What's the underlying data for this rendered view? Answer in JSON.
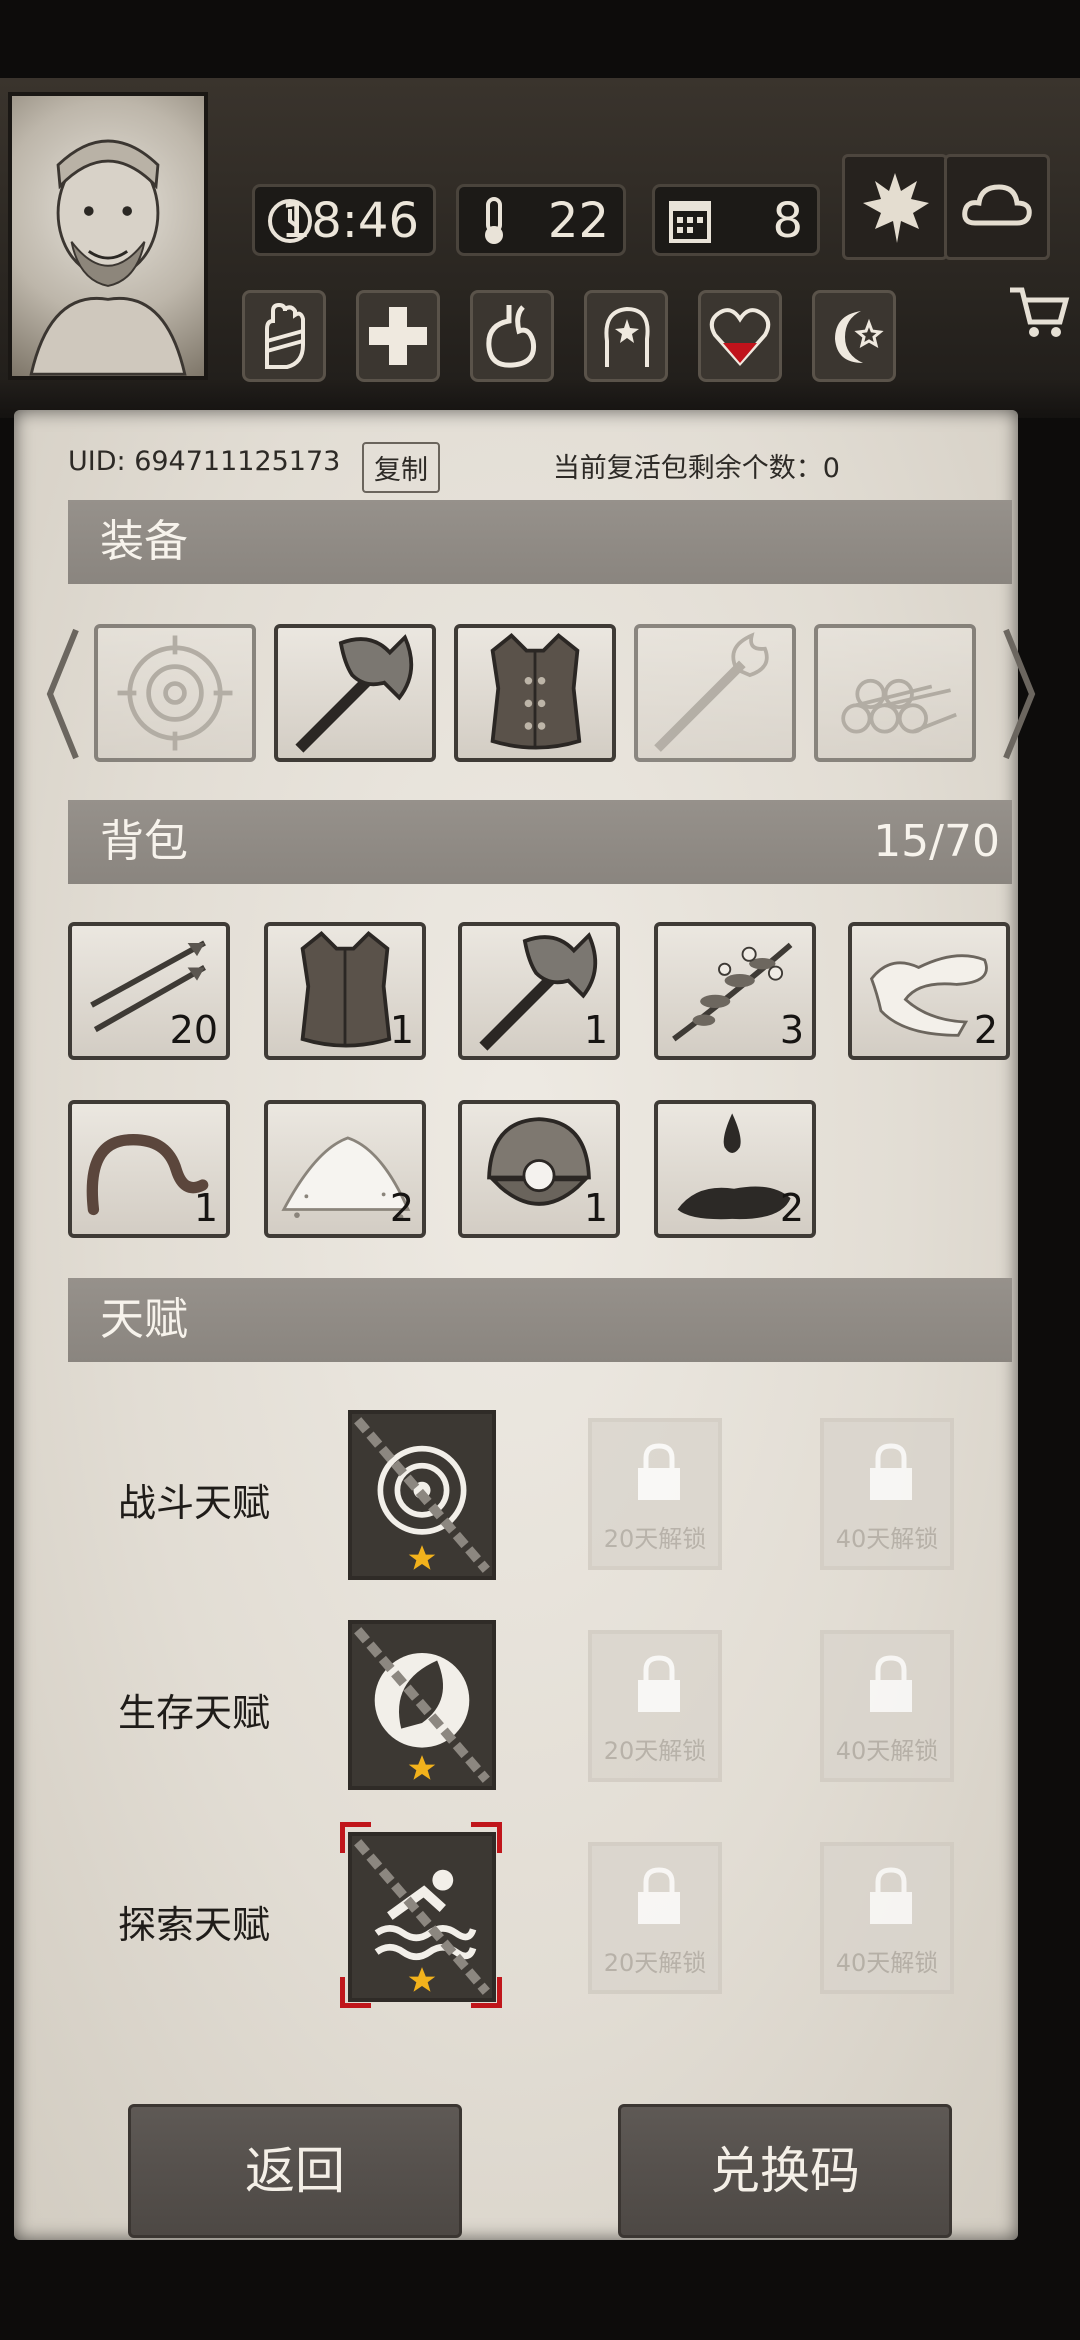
{
  "hud": {
    "time": "18:46",
    "temperature": "22",
    "day": "8"
  },
  "account": {
    "uid_text": "UID: 694711125173",
    "copy_label": "复制",
    "revive_text": "当前复活包剩余个数：0"
  },
  "equipment": {
    "title": "装备",
    "slots": [
      "target-icon",
      "axe-icon",
      "vest-icon",
      "torch-icon",
      "logs-icon"
    ]
  },
  "backpack": {
    "title": "背包",
    "count": "15/70",
    "items": [
      {
        "icon": "arrows-icon",
        "qty": "20"
      },
      {
        "icon": "vest-icon",
        "qty": "1"
      },
      {
        "icon": "axe-icon",
        "qty": "1"
      },
      {
        "icon": "herb-branch-icon",
        "qty": "3"
      },
      {
        "icon": "cloth-strip-icon",
        "qty": "2"
      },
      {
        "icon": "worm-icon",
        "qty": "1"
      },
      {
        "icon": "salt-pile-icon",
        "qty": "2"
      },
      {
        "icon": "pearl-shell-icon",
        "qty": "1"
      },
      {
        "icon": "oil-drop-icon",
        "qty": "2"
      }
    ]
  },
  "talents": {
    "title": "天赋",
    "rows": [
      {
        "label": "战斗天赋",
        "lock1": "20天解锁",
        "lock2": "40天解锁"
      },
      {
        "label": "生存天赋",
        "lock1": "20天解锁",
        "lock2": "40天解锁"
      },
      {
        "label": "探索天赋",
        "lock1": "20天解锁",
        "lock2": "40天解锁"
      }
    ]
  },
  "buttons": {
    "back": "返回",
    "redeem": "兑换码"
  },
  "colors": {
    "panel": "#e6e1d9",
    "section_bar": "#8f8a84",
    "selection": "#c0161b",
    "star": "#f2b21c"
  }
}
